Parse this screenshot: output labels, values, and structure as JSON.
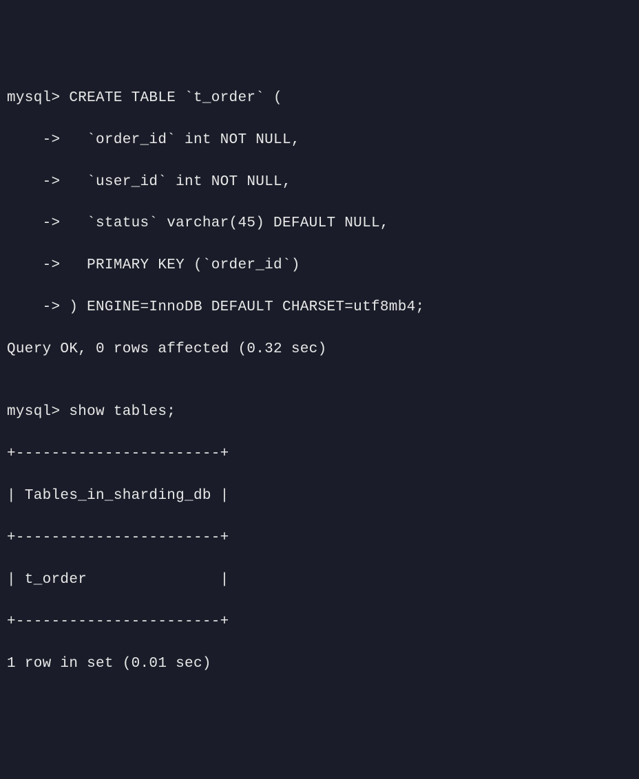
{
  "terminal": {
    "lines": [
      "mysql> CREATE TABLE `t_order` (",
      "    ->   `order_id` int NOT NULL,",
      "    ->   `user_id` int NOT NULL,",
      "    ->   `status` varchar(45) DEFAULT NULL,",
      "    ->   PRIMARY KEY (`order_id`)",
      "    -> ) ENGINE=InnoDB DEFAULT CHARSET=utf8mb4;",
      "Query OK, 0 rows affected (0.32 sec)",
      "",
      "mysql> show tables;",
      "+-----------------------+",
      "| Tables_in_sharding_db |",
      "+-----------------------+",
      "| t_order               |",
      "+-----------------------+",
      "1 row in set (0.01 sec)"
    ]
  },
  "chart_data": {
    "type": "table",
    "title": "Tables_in_sharding_db",
    "columns": [
      "Tables_in_sharding_db"
    ],
    "rows": [
      [
        "t_order"
      ]
    ],
    "row_count_text": "1 row in set (0.01 sec)"
  }
}
